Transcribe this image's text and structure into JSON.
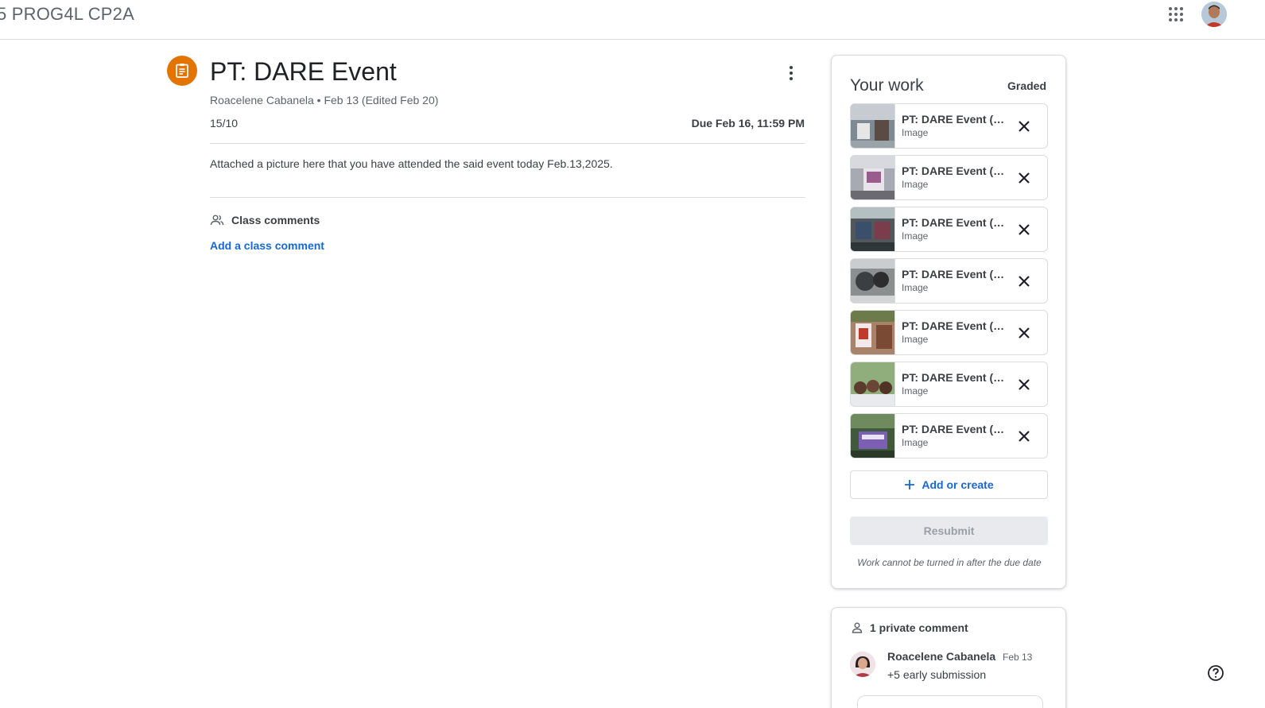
{
  "topbar": {
    "class_title": "5 PROG4L CP2A",
    "apps_icon": "apps-grid-icon",
    "account_icon": "account-avatar"
  },
  "assignment": {
    "icon": "assignment-icon",
    "title": "PT: DARE Event",
    "meta": "Roacelene Cabanela • Feb 13 (Edited Feb 20)",
    "points": "15/10",
    "due": "Due Feb 16, 11:59 PM",
    "instructions": "Attached a picture here that you have attended the said event today Feb.13,2025.",
    "class_comments_label": "Class comments",
    "add_class_comment": "Add a class comment"
  },
  "your_work": {
    "title": "Your work",
    "status": "Graded",
    "attachments": [
      {
        "name": "PT: DARE Event (1...",
        "type": "Image"
      },
      {
        "name": "PT: DARE Event (1...",
        "type": "Image"
      },
      {
        "name": "PT: DARE Event (1...",
        "type": "Image"
      },
      {
        "name": "PT: DARE Event (1...",
        "type": "Image"
      },
      {
        "name": "PT: DARE Event (1...",
        "type": "Image"
      },
      {
        "name": "PT: DARE Event (1...",
        "type": "Image"
      },
      {
        "name": "PT: DARE Event (1...",
        "type": "Image"
      }
    ],
    "add_or_create": "Add or create",
    "resubmit": "Resubmit",
    "late_note": "Work cannot be turned in after the due date"
  },
  "private_comments": {
    "header": "1 private comment",
    "comments": [
      {
        "author": "Roacelene Cabanela",
        "date": "Feb 13",
        "text": "+5 early submission"
      }
    ]
  },
  "colors": {
    "accent": "#1967d2",
    "assignment_icon_bg": "#e37400",
    "divider": "#dadce0"
  }
}
